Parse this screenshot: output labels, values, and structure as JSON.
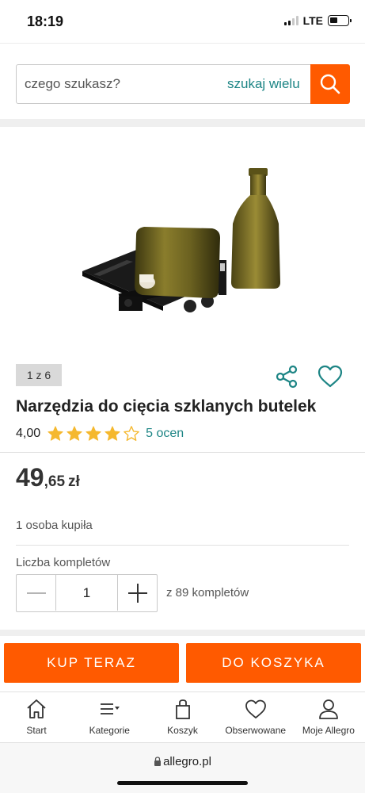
{
  "status_bar": {
    "time": "18:19",
    "network": "LTE"
  },
  "search": {
    "placeholder": "czego szukasz?",
    "search_many_label": "szukaj wielu"
  },
  "gallery": {
    "counter": "1 z 6"
  },
  "product": {
    "title": "Narzędzia do cięcia szklanych butelek",
    "rating": "4,00",
    "rating_stars": 4,
    "reviews_label": "5 ocen",
    "price_integer": "49",
    "price_decimal": ",65",
    "price_currency": "zł",
    "buyers_text": "1 osoba kupiła"
  },
  "quantity": {
    "label": "Liczba kompletów",
    "value": "1",
    "available": "z 89 kompletów"
  },
  "actions": {
    "buy_now": "KUP TERAZ",
    "add_to_cart": "DO KOSZYKA"
  },
  "tabbar": {
    "items": [
      {
        "label": "Start",
        "icon": "home-icon"
      },
      {
        "label": "Kategorie",
        "icon": "menu-icon"
      },
      {
        "label": "Koszyk",
        "icon": "bag-icon"
      },
      {
        "label": "Obserwowane",
        "icon": "heart-icon"
      },
      {
        "label": "Moje Allegro",
        "icon": "user-icon"
      }
    ]
  },
  "browser": {
    "url": "allegro.pl"
  },
  "colors": {
    "accent": "#ff5a00",
    "link": "#1d8585",
    "star": "#f5b82e"
  }
}
